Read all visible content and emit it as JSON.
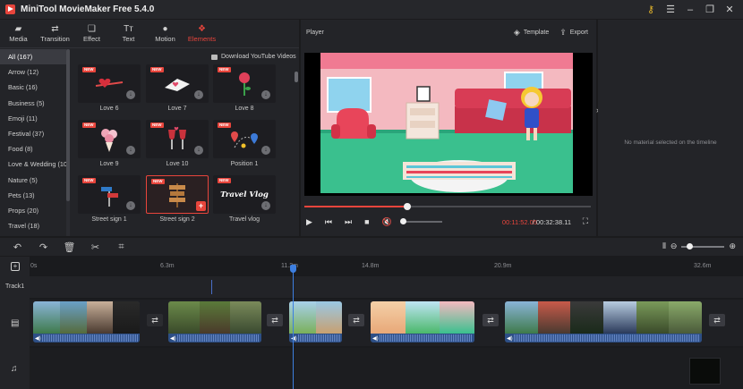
{
  "app": {
    "title": "MiniTool MovieMaker Free 5.4.0"
  },
  "toolbar": [
    {
      "label": "Media",
      "icon": "folder-icon"
    },
    {
      "label": "Transition",
      "icon": "transition-icon"
    },
    {
      "label": "Effect",
      "icon": "effect-icon"
    },
    {
      "label": "Text",
      "icon": "text-icon"
    },
    {
      "label": "Motion",
      "icon": "motion-icon"
    },
    {
      "label": "Elements",
      "icon": "elements-icon",
      "active": true
    }
  ],
  "categories": [
    {
      "label": "All (167)",
      "active": true
    },
    {
      "label": "Arrow (12)"
    },
    {
      "label": "Basic (16)"
    },
    {
      "label": "Business (5)"
    },
    {
      "label": "Emoji (11)"
    },
    {
      "label": "Festival (37)"
    },
    {
      "label": "Food (8)"
    },
    {
      "label": "Love & Wedding (10)"
    },
    {
      "label": "Nature (5)"
    },
    {
      "label": "Pets (13)"
    },
    {
      "label": "Props (20)"
    },
    {
      "label": "Travel (18)"
    }
  ],
  "elements": {
    "download_youtube": "Download YouTube Videos",
    "new_badge": "NEW",
    "items": [
      {
        "label": "Love 6"
      },
      {
        "label": "Love 7"
      },
      {
        "label": "Love 8"
      },
      {
        "label": "Love 9"
      },
      {
        "label": "Love 10"
      },
      {
        "label": "Position 1"
      },
      {
        "label": "Street sign 1"
      },
      {
        "label": "Street sign 2",
        "selected": true
      },
      {
        "label": "Travel vlog",
        "thumb_text": "Travel Vlog"
      }
    ]
  },
  "player": {
    "label": "Player",
    "template_label": "Template",
    "export_label": "Export",
    "current_time": "00:11:52.05",
    "total_time": "/ 00:32:38.11",
    "progress": 0.36
  },
  "properties": {
    "empty_message": "No material selected on the timeline"
  },
  "timeline": {
    "ruler": [
      "0s",
      "6.3m",
      "11.2m",
      "14.8m",
      "20.9m",
      "32.6m"
    ],
    "track1_label": "Track1"
  },
  "colors": {
    "accent": "#e8453c",
    "playhead": "#3d7fe0",
    "bg": "#1b1b1d",
    "panel": "#232428"
  }
}
